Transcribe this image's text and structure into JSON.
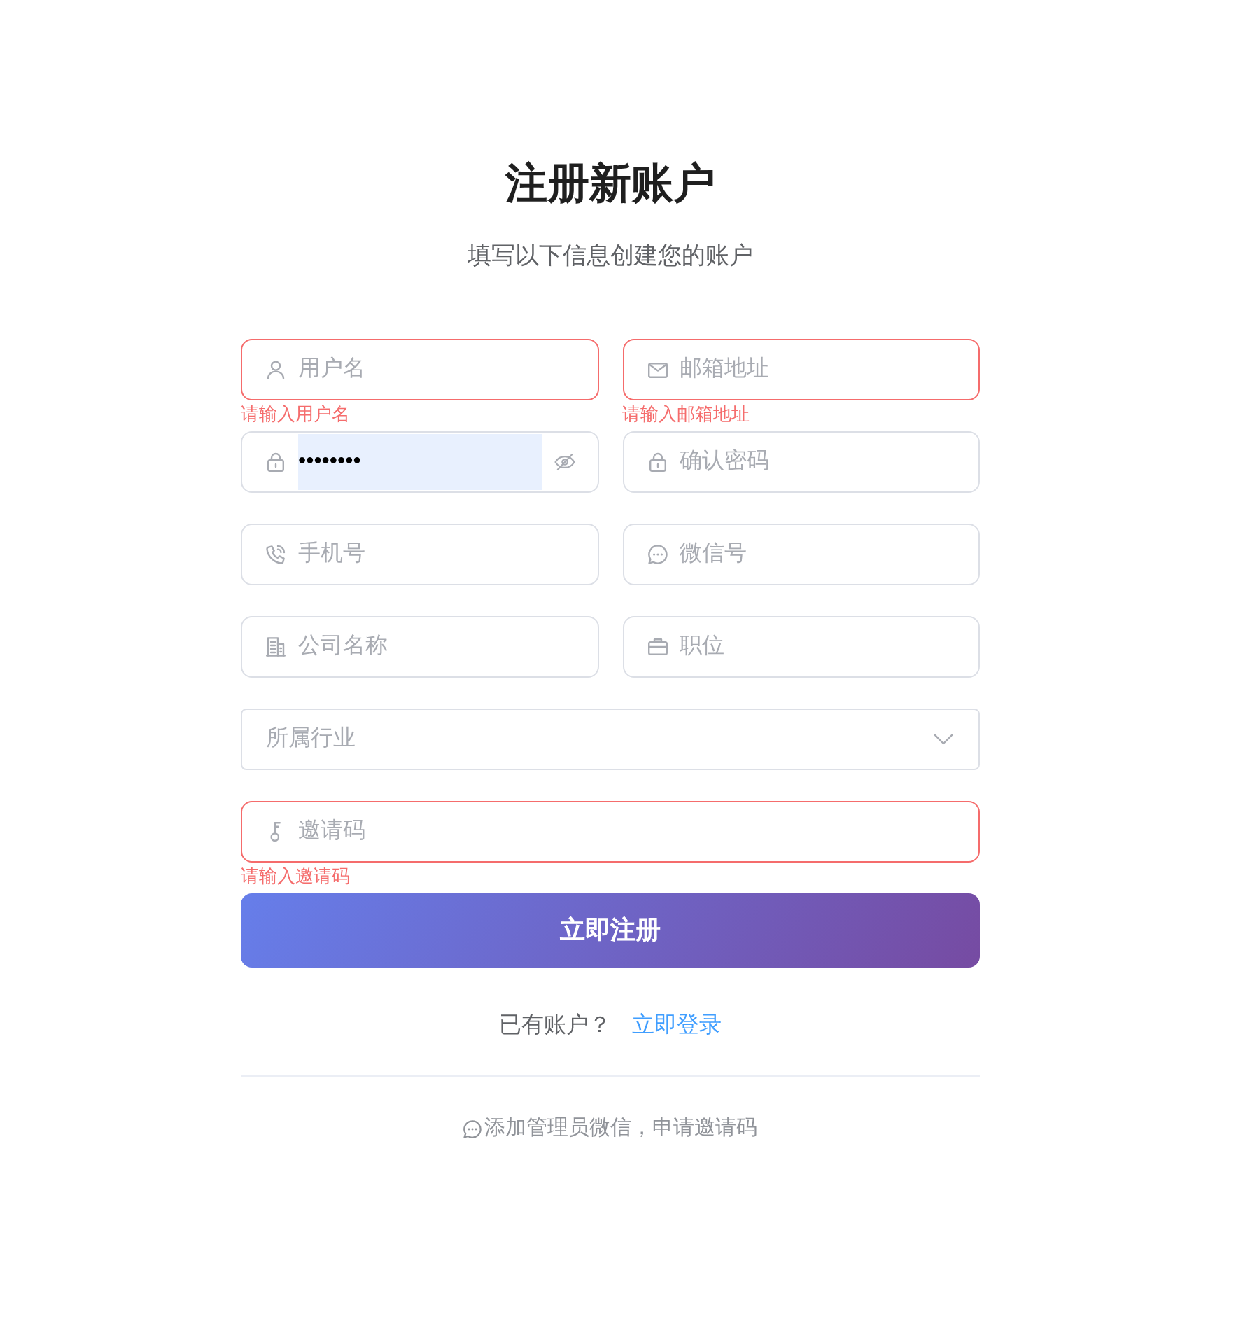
{
  "header": {
    "title": "注册新账户",
    "subtitle": "填写以下信息创建您的账户"
  },
  "rows": [
    [
      {
        "kind": "user",
        "placeholder": "用户名",
        "invalid": true,
        "error": "请输入用户名"
      },
      {
        "kind": "email",
        "placeholder": "邮箱地址",
        "invalid": true,
        "error": "请输入邮箱地址"
      }
    ],
    [
      {
        "kind": "password",
        "value": "••••••••",
        "invalid": false,
        "revealed": false
      },
      {
        "kind": "password",
        "placeholder": "确认密码",
        "invalid": false
      }
    ],
    [
      {
        "kind": "phone",
        "placeholder": "手机号",
        "invalid": false
      },
      {
        "kind": "wechat",
        "placeholder": "微信号",
        "invalid": false
      }
    ],
    [
      {
        "kind": "company",
        "placeholder": "公司名称",
        "invalid": false
      },
      {
        "kind": "job",
        "placeholder": "职位",
        "invalid": false
      }
    ],
    [
      {
        "kind": "select",
        "placeholder": "所属行业",
        "invalid": false
      }
    ],
    [
      {
        "kind": "invite",
        "placeholder": "邀请码",
        "invalid": true,
        "error": "请输入邀请码"
      }
    ]
  ],
  "submit": "立即注册",
  "login": {
    "prompt": "已有账户？",
    "link": "立即登录"
  },
  "footer": {
    "note": "添加管理员微信，申请邀请码"
  }
}
